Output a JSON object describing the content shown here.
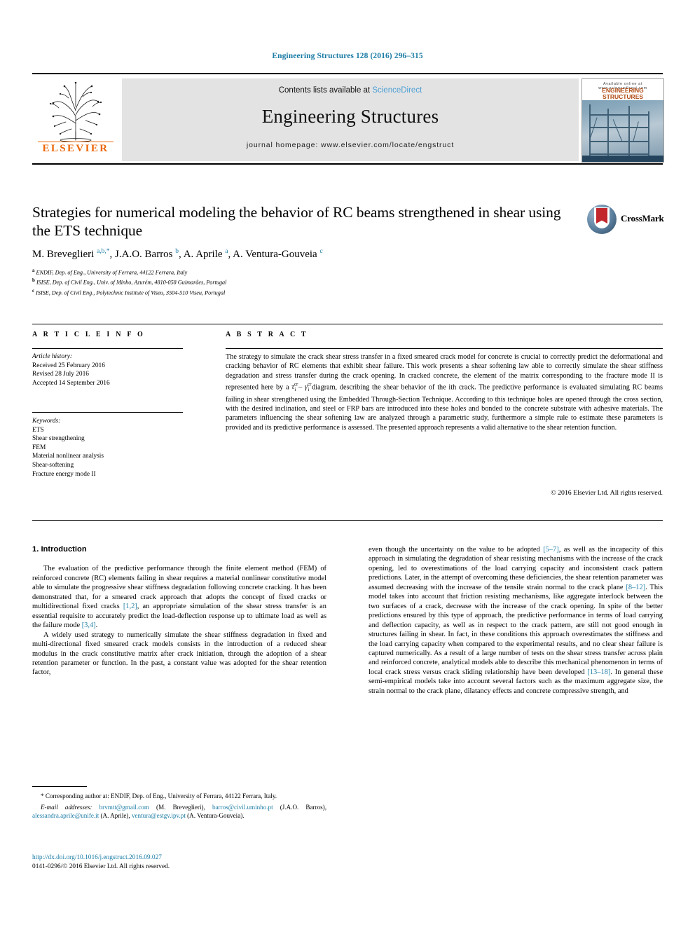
{
  "running_head": "Engineering Structures 128 (2016) 296–315",
  "masthead": {
    "contents_prefix": "Contents lists available at ",
    "sciencedirect": "ScienceDirect",
    "journal_title": "Engineering Structures",
    "homepage": "journal homepage: www.elsevier.com/locate/engstruct",
    "publisher": "ELSEVIER",
    "cover": {
      "top_label": "Available online at www.sciencedirect.com",
      "title_line1": "ENGINEERING",
      "title_line2": "STRUCTURES"
    }
  },
  "article": {
    "title": "Strategies for numerical modeling the behavior of RC beams strengthened in shear using the ETS technique",
    "authors_html": "M. Breveglieri <sup>a,b,</sup><sup>*</sup>, J.A.O. Barros <sup>b</sup>, A. Aprile <sup>a</sup>, A. Ventura-Gouveia <sup>c</sup>",
    "affiliations": [
      "ENDIF, Dep. of Eng., University of Ferrara, 44122 Ferrara, Italy",
      "ISISE, Dep. of Civil Eng., Univ. of Minho, Azurém, 4810-058 Guimarães, Portugal",
      "ISISE, Dep. of Civil Eng., Polytechnic Institute of Viseu, 3504-510 Viseu, Portugal"
    ],
    "affiliation_marks": [
      "a",
      "b",
      "c"
    ],
    "crossmark_label": "CrossMark"
  },
  "info": {
    "heading": "A R T I C L E    I N F O",
    "history_label": "Article history:",
    "history": [
      "Received 25 February 2016",
      "Revised 28 July 2016",
      "Accepted 14 September 2016"
    ],
    "keywords_label": "Keywords:",
    "keywords": [
      "ETS",
      "Shear strengthening",
      "FEM",
      "Material nonlinear analysis",
      "Shear-softening",
      "Fracture energy mode II"
    ]
  },
  "abstract": {
    "heading": "A B S T R A C T",
    "text_part1": "The strategy to simulate the crack shear stress transfer in a fixed smeared crack model for concrete is crucial to correctly predict the deformational and cracking behavior of RC elements that exhibit shear failure. This work presents a shear softening law able to correctly simulate the shear stiffness degradation and stress transfer during the crack opening. In cracked concrete, the element of the matrix corresponding to the fracture mode II is represented here by a ",
    "formula": "τ – γ",
    "text_part2": " diagram, describing the shear behavior of the ith crack. The predictive performance is evaluated simulating RC beams failing in shear strengthened using the Embedded Through-Section Technique. According to this technique holes are opened through the cross section, with the desired inclination, and steel or FRP bars are introduced into these holes and bonded to the concrete substrate with adhesive materials. The parameters influencing the shear softening law are analyzed through a parametric study, furthermore a simple rule to estimate these parameters is provided and its predictive performance is assessed. The presented approach represents a valid alternative to the shear retention function.",
    "copyright": "© 2016 Elsevier Ltd. All rights reserved."
  },
  "body": {
    "section_heading": "1. Introduction",
    "left_p1_a": "The evaluation of the predictive performance through the finite element method (FEM) of reinforced concrete (RC) elements failing in shear requires a material nonlinear constitutive model able to simulate the progressive shear stiffness degradation following concrete cracking. It has been demonstrated that, for a smeared crack approach that adopts the concept of fixed cracks or multidirectional fixed cracks ",
    "left_p1_ref1": "[1,2]",
    "left_p1_b": ", an appropriate simulation of the shear stress transfer is an essential requisite to accurately predict the load-deflection response up to ultimate load as well as the failure mode ",
    "left_p1_ref2": "[3,4]",
    "left_p1_c": ".",
    "left_p2": "A widely used strategy to numerically simulate the shear stiffness degradation in fixed and multi-directional fixed smeared crack models consists in the introduction of a reduced shear modulus in the crack constitutive matrix after crack initiation, through the adoption of a shear retention parameter or function. In the past, a constant value was adopted for the shear retention factor,",
    "right_a": "even though the uncertainty on the value to be adopted ",
    "right_ref1": "[5–7]",
    "right_b": ", as well as the incapacity of this approach in simulating the degradation of shear resisting mechanisms with the increase of the crack opening, led to overestimations of the load carrying capacity and inconsistent crack pattern predictions. Later, in the attempt of overcoming these deficiencies, the shear retention parameter was assumed decreasing with the increase of the tensile strain normal to the crack plane ",
    "right_ref2": "[8–12]",
    "right_c": ". This model takes into account that friction resisting mechanisms, like aggregate interlock between the two surfaces of a crack, decrease with the increase of the crack opening. In spite of the better predictions ensured by this type of approach, the predictive performance in terms of load carrying and deflection capacity, as well as in respect to the crack pattern, are still not good enough in structures failing in shear. In fact, in these conditions this approach overestimates the stiffness and the load carrying capacity when compared to the experimental results, and no clear shear failure is captured numerically. As a result of a large number of tests on the shear stress transfer across plain and reinforced concrete, analytical models able to describe this mechanical phenomenon in terms of local crack stress versus crack sliding relationship have been developed ",
    "right_ref3": "[13–18]",
    "right_d": ". In general these semi-empirical models take into account several factors such as the maximum aggregate size, the strain normal to the crack plane, dilatancy effects and concrete compressive strength, and"
  },
  "footnote": {
    "star": "*",
    "corresponding": " Corresponding author at: ENDIF, Dep. of Eng., University of Ferrara, 44122 Ferrara, Italy.",
    "email_label": "E-mail addresses:",
    "emails": [
      {
        "address": "brvmtt@gmail.com",
        "name": "(M. Breveglieri)"
      },
      {
        "address": "barros@civil.uminho.pt",
        "name": "(J.A.O. Barros)"
      },
      {
        "address": "alessandra.aprile@unife.it",
        "name": "(A. Aprile)"
      },
      {
        "address": "ventura@estgv.ipv.pt",
        "name": "(A. Ventura-Gouveia)"
      }
    ]
  },
  "doi": {
    "url": "http://dx.doi.org/10.1016/j.engstruct.2016.09.027",
    "issn_line": "0141-0296/© 2016 Elsevier Ltd. All rights reserved."
  },
  "colors": {
    "link": "#1a7ba5",
    "sciencedirect": "#4a9fd5",
    "elsevier_orange": "#ec6608",
    "masthead_bg": "#e3e3e3"
  }
}
